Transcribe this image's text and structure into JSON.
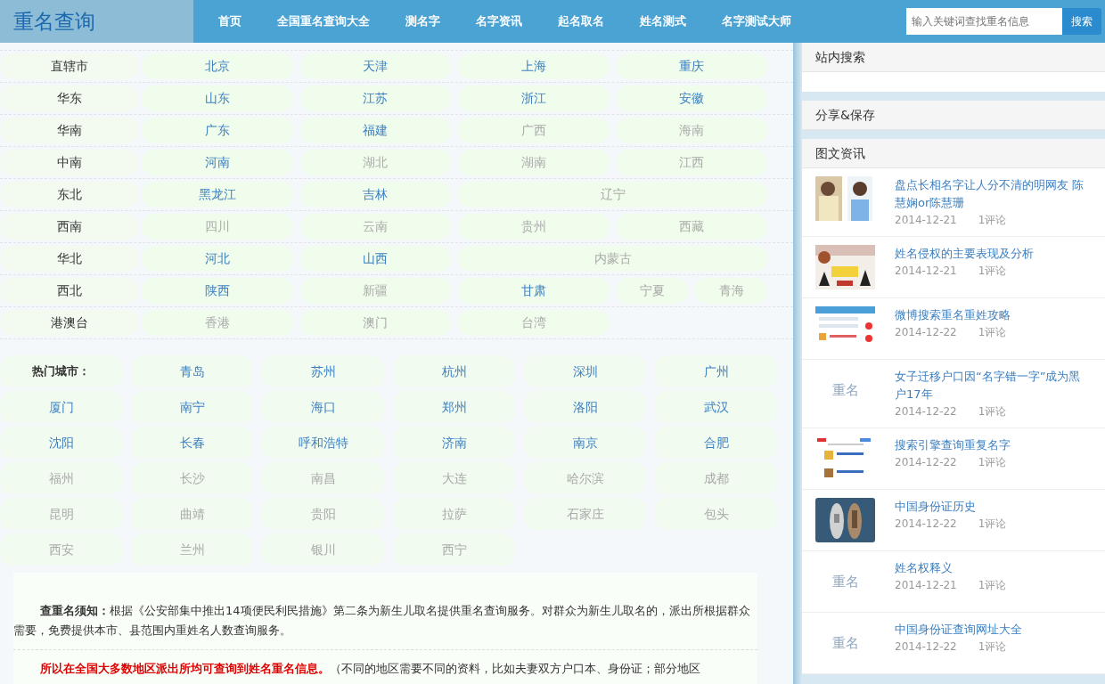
{
  "header": {
    "logo": "重名查询",
    "nav": [
      {
        "label": "首页"
      },
      {
        "label": "全国重名查询大全"
      },
      {
        "label": "测名字"
      },
      {
        "label": "名字资讯"
      },
      {
        "label": "起名取名"
      },
      {
        "label": "姓名测式"
      },
      {
        "label": "名字测试大师"
      }
    ],
    "search": {
      "placeholder": "输入关键词查找重名信息",
      "button": "搜索"
    }
  },
  "regions": [
    {
      "label": "直辖市",
      "cells": [
        {
          "places": [
            {
              "name": "北京",
              "linked": true
            }
          ]
        },
        {
          "places": [
            {
              "name": "天津",
              "linked": true
            }
          ]
        },
        {
          "places": [
            {
              "name": "上海",
              "linked": true
            }
          ]
        },
        {
          "places": [
            {
              "name": "重庆",
              "linked": true
            }
          ]
        }
      ]
    },
    {
      "label": "华东",
      "cells": [
        {
          "places": [
            {
              "name": "山东",
              "linked": true
            }
          ]
        },
        {
          "places": [
            {
              "name": "江苏",
              "linked": true
            }
          ]
        },
        {
          "places": [
            {
              "name": "浙江",
              "linked": true
            }
          ]
        },
        {
          "places": [
            {
              "name": "安徽",
              "linked": true
            }
          ]
        }
      ]
    },
    {
      "label": "华南",
      "cells": [
        {
          "places": [
            {
              "name": "广东",
              "linked": true
            }
          ]
        },
        {
          "places": [
            {
              "name": "福建",
              "linked": true
            }
          ]
        },
        {
          "places": [
            {
              "name": "广西",
              "linked": false
            }
          ]
        },
        {
          "places": [
            {
              "name": "海南",
              "linked": false
            }
          ]
        }
      ]
    },
    {
      "label": "中南",
      "cells": [
        {
          "places": [
            {
              "name": "河南",
              "linked": true
            }
          ]
        },
        {
          "places": [
            {
              "name": "湖北",
              "linked": false
            }
          ]
        },
        {
          "places": [
            {
              "name": "湖南",
              "linked": false
            }
          ]
        },
        {
          "places": [
            {
              "name": "江西",
              "linked": false
            }
          ]
        }
      ]
    },
    {
      "label": "东北",
      "cells": [
        {
          "places": [
            {
              "name": "黑龙江",
              "linked": true
            }
          ]
        },
        {
          "places": [
            {
              "name": "吉林",
              "linked": true
            }
          ]
        },
        {
          "wide": true,
          "places": [
            {
              "name": "辽宁",
              "linked": false
            }
          ]
        }
      ]
    },
    {
      "label": "西南",
      "cells": [
        {
          "places": [
            {
              "name": "四川",
              "linked": false
            }
          ]
        },
        {
          "places": [
            {
              "name": "云南",
              "linked": false
            }
          ]
        },
        {
          "places": [
            {
              "name": "贵州",
              "linked": false
            }
          ]
        },
        {
          "places": [
            {
              "name": "西藏",
              "linked": false
            }
          ]
        }
      ]
    },
    {
      "label": "华北",
      "cells": [
        {
          "places": [
            {
              "name": "河北",
              "linked": true
            }
          ]
        },
        {
          "places": [
            {
              "name": "山西",
              "linked": true
            }
          ]
        },
        {
          "wide": true,
          "places": [
            {
              "name": "内蒙古",
              "linked": false
            }
          ]
        }
      ]
    },
    {
      "label": "西北",
      "cells": [
        {
          "places": [
            {
              "name": "陕西",
              "linked": true
            }
          ]
        },
        {
          "places": [
            {
              "name": "新疆",
              "linked": false
            }
          ]
        },
        {
          "places": [
            {
              "name": "甘肃",
              "linked": true
            }
          ]
        },
        {
          "places": [
            {
              "name": "宁夏",
              "linked": false
            },
            {
              "name": "青海",
              "linked": false
            }
          ]
        }
      ]
    },
    {
      "label": "港澳台",
      "cells": [
        {
          "places": [
            {
              "name": "香港",
              "linked": false
            }
          ]
        },
        {
          "places": [
            {
              "name": "澳门",
              "linked": false
            }
          ]
        },
        {
          "places": [
            {
              "name": "台湾",
              "linked": false
            }
          ]
        }
      ]
    }
  ],
  "hot_cities": {
    "label": "热门城市：",
    "cities": [
      {
        "name": "青岛",
        "linked": true
      },
      {
        "name": "苏州",
        "linked": true
      },
      {
        "name": "杭州",
        "linked": true
      },
      {
        "name": "深圳",
        "linked": true
      },
      {
        "name": "广州",
        "linked": true
      },
      {
        "name": "厦门",
        "linked": true
      },
      {
        "name": "南宁",
        "linked": true
      },
      {
        "name": "海口",
        "linked": true
      },
      {
        "name": "郑州",
        "linked": true
      },
      {
        "name": "洛阳",
        "linked": true
      },
      {
        "name": "武汉",
        "linked": true
      },
      {
        "name": "沈阳",
        "linked": true
      },
      {
        "name": "长春",
        "linked": true
      },
      {
        "name": "呼和浩特",
        "linked": true
      },
      {
        "name": "济南",
        "linked": true
      },
      {
        "name": "南京",
        "linked": true
      },
      {
        "name": "合肥",
        "linked": true
      },
      {
        "name": "福州",
        "linked": false
      },
      {
        "name": "长沙",
        "linked": false
      },
      {
        "name": "南昌",
        "linked": false
      },
      {
        "name": "大连",
        "linked": false
      },
      {
        "name": "哈尔滨",
        "linked": false
      },
      {
        "name": "成都",
        "linked": false
      },
      {
        "name": "昆明",
        "linked": false
      },
      {
        "name": "曲靖",
        "linked": false
      },
      {
        "name": "贵阳",
        "linked": false
      },
      {
        "name": "拉萨",
        "linked": false
      },
      {
        "name": "石家庄",
        "linked": false
      },
      {
        "name": "包头",
        "linked": false
      },
      {
        "name": "西安",
        "linked": false
      },
      {
        "name": "兰州",
        "linked": false
      },
      {
        "name": "银川",
        "linked": false
      },
      {
        "name": "西宁",
        "linked": false
      }
    ]
  },
  "notice": [
    {
      "lead": "查重名须知：",
      "text": "根据《公安部集中推出14项便民利民措施》第二条为新生儿取名提供重名查询服务。对群众为新生儿取名的，派出所根据群众需要，免费提供本市、县范围内重姓名人数查询服务。"
    },
    {
      "lead": "所以在全国大多数地区派出所均可查询到姓名重名信息。",
      "text": "（不同的地区需要不同的资料，比如夫妻双方户口本、身份证；部分地区"
    }
  ],
  "sidebar": {
    "site_search": {
      "title": "站内搜索"
    },
    "share": {
      "title": "分享&保存"
    },
    "news": {
      "title": "图文资讯",
      "items": [
        {
          "kind": "picture",
          "title": "盘点长相名字让人分不清的明网友 陈慧娴or陈慧珊",
          "date": "2014-12-21",
          "comments": "1评论"
        },
        {
          "kind": "picture",
          "title": "姓名侵权的主要表现及分析",
          "date": "2014-12-21",
          "comments": "1评论"
        },
        {
          "kind": "picture",
          "title": "微博搜索重名重姓攻略",
          "date": "2014-12-22",
          "comments": "1评论"
        },
        {
          "kind": "label",
          "thumb_text": "重名",
          "title": "女子迁移户口因“名字错一字”成为黑户17年",
          "date": "2014-12-22",
          "comments": "1评论"
        },
        {
          "kind": "picture",
          "title": "搜索引擎查询重复名字",
          "date": "2014-12-22",
          "comments": "1评论"
        },
        {
          "kind": "picture",
          "title": "中国身份证历史",
          "date": "2014-12-22",
          "comments": "1评论"
        },
        {
          "kind": "label",
          "thumb_text": "重名",
          "title": "姓名权释义",
          "date": "2014-12-21",
          "comments": "1评论"
        },
        {
          "kind": "label",
          "thumb_text": "重名",
          "title": "中国身份证查询网址大全",
          "date": "2014-12-22",
          "comments": "1评论"
        }
      ]
    }
  }
}
